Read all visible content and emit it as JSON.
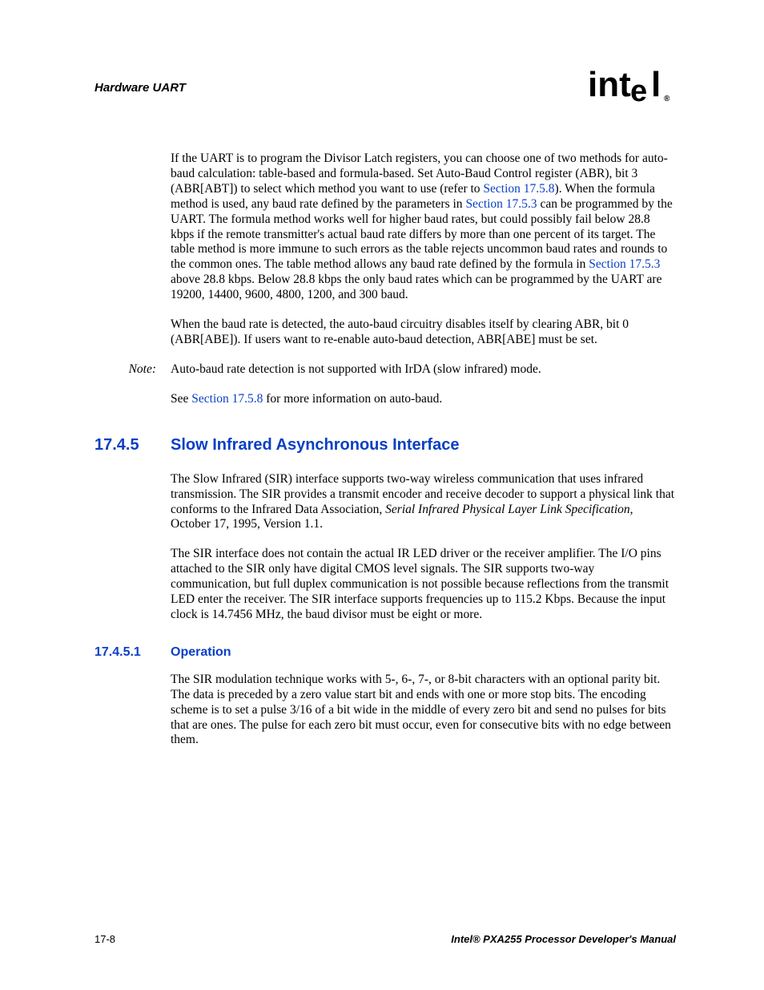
{
  "header": {
    "section": "Hardware UART",
    "logo_text": "intel",
    "logo_reg": "®"
  },
  "body": {
    "p1a": "If the UART is to program the Divisor Latch registers, you can choose one of two methods for auto-baud calculation: table-based and formula-based. Set Auto-Baud Control register (ABR), bit 3 (ABR[ABT]) to select which method you want to use (refer to ",
    "p1_link1": "Section 17.5.8",
    "p1b": "). When the formula method is used, any baud rate defined by the parameters in ",
    "p1_link2": "Section 17.5.3",
    "p1c": " can be programmed by the UART. The formula method works well for higher baud rates, but could possibly fail below 28.8 kbps if the remote transmitter's actual baud rate differs by more than one percent of its target. The table method is more immune to such errors as the table rejects uncommon baud rates and rounds to the common ones. The table method allows any baud rate defined by the formula in ",
    "p1_link3": "Section 17.5.3",
    "p1d": " above 28.8 kbps. Below 28.8 kbps the only baud rates which can be programmed by the UART are 19200, 14400, 9600, 4800, 1200, and 300 baud.",
    "p2": "When the baud rate is detected, the auto-baud circuitry disables itself by clearing ABR, bit 0 (ABR[ABE]). If users want to re-enable auto-baud detection, ABR[ABE] must be set.",
    "note_label": "Note:",
    "note_text": "Auto-baud rate detection is not supported with IrDA (slow infrared) mode.",
    "p3a": "See ",
    "p3_link": "Section 17.5.8",
    "p3b": " for more information on auto-baud."
  },
  "h2": {
    "num": "17.4.5",
    "title": "Slow Infrared Asynchronous Interface"
  },
  "sir": {
    "p1a": "The Slow Infrared (SIR) interface supports two-way wireless communication that uses infrared transmission. The SIR provides a transmit encoder and receive decoder to support a physical link that conforms to the Infrared Data Association, ",
    "p1_i": "Serial Infrared Physical Layer Link Specification",
    "p1b": ", October 17, 1995, Version 1.1.",
    "p2": "The SIR interface does not contain the actual IR LED driver or the receiver amplifier. The I/O pins attached to the SIR only have digital CMOS level signals. The SIR supports two-way communication, but full duplex communication is not possible because reflections from the transmit LED enter the receiver. The SIR interface supports frequencies up to 115.2 Kbps. Because the input clock is 14.7456 MHz, the baud divisor must be eight or more."
  },
  "h3": {
    "num": "17.4.5.1",
    "title": "Operation"
  },
  "op": {
    "p1": "The SIR modulation technique works with 5-, 6-, 7-, or 8-bit characters with an optional parity bit. The data is preceded by a zero value start bit and ends with one or more stop bits. The encoding scheme is to set a pulse 3/16 of a bit wide in the middle of every zero bit and send no pulses for bits that are ones. The pulse for each zero bit must occur, even for consecutive bits with no edge between them."
  },
  "footer": {
    "page": "17-8",
    "manual": "Intel® PXA255 Processor Developer's Manual"
  }
}
